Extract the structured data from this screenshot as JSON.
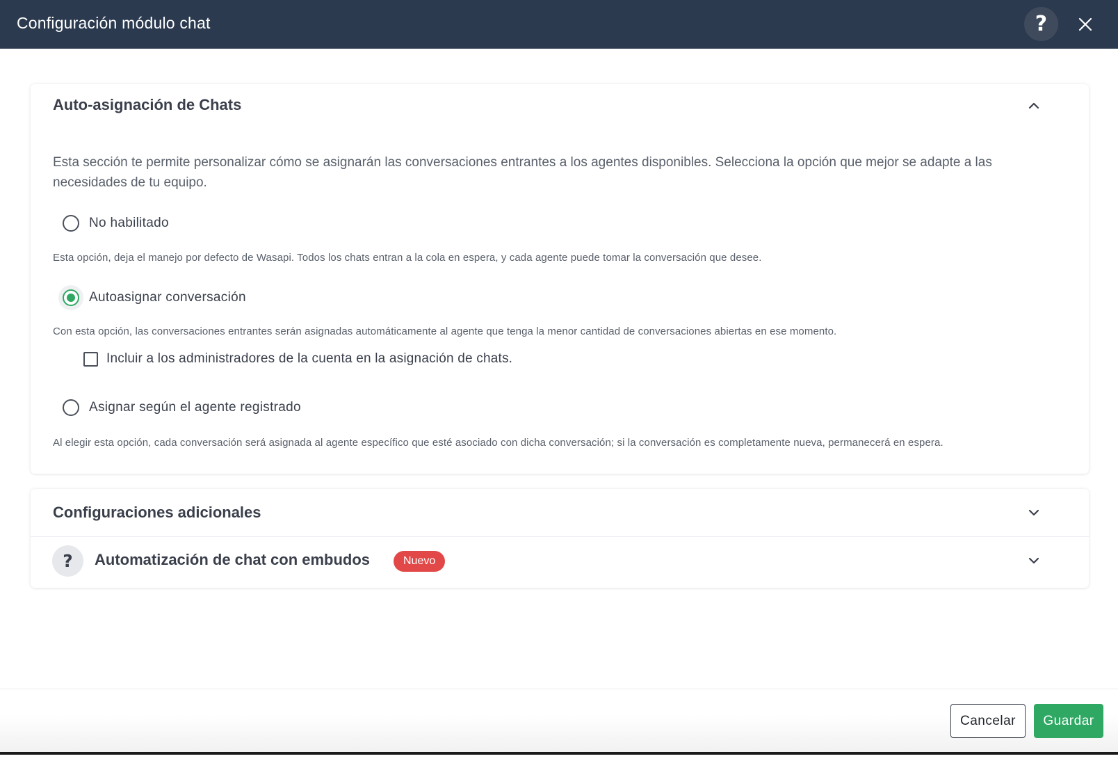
{
  "header": {
    "title": "Configuración módulo chat",
    "help_label": "?"
  },
  "auto_assign": {
    "title": "Auto-asignación de Chats",
    "intro": "Esta sección te permite personalizar cómo se asignarán las conversaciones entrantes a los agentes disponibles. Selecciona la opción que mejor se adapte a las necesidades de tu equipo.",
    "options": [
      {
        "label": "No habilitado",
        "description": "Esta opción, deja el manejo por defecto de Wasapi. Todos los chats entran a la cola en espera, y cada agente puede tomar la conversación que desee.",
        "selected": false
      },
      {
        "label": "Autoasignar conversación",
        "description": "Con esta opción, las conversaciones entrantes serán asignadas automáticamente al agente que tenga la menor cantidad de conversaciones abiertas en ese momento.",
        "selected": true
      },
      {
        "label": "Asignar según el agente registrado",
        "description": "Al elegir esta opción, cada conversación será asignada al agente específico que esté asociado con dicha conversación; si la conversación es completamente nueva, permanecerá en espera.",
        "selected": false
      }
    ],
    "include_admins_label": "Incluir a los administradores de la cuenta en la asignación de chats.",
    "include_admins_checked": false
  },
  "additional": {
    "title": "Configuraciones adicionales",
    "funnels_help": "?",
    "funnels_title": "Automatización de chat con embudos",
    "funnels_badge": "Nuevo"
  },
  "footer": {
    "cancel_label": "Cancelar",
    "save_label": "Guardar"
  },
  "colors": {
    "header_bg": "#2b3a4f",
    "accent": "#2fa863",
    "badge": "#e24848"
  }
}
